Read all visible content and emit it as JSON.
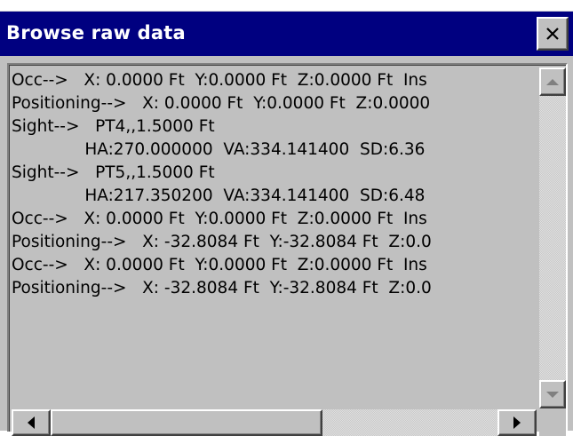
{
  "window": {
    "title": "Browse raw data",
    "close_icon": "close-icon",
    "colors": {
      "titlebar": "#000080",
      "title_text": "#ffffff",
      "face": "#c0c0c0"
    }
  },
  "raw_data": {
    "lines": [
      "Occ-->   X: 0.0000 Ft  Y:0.0000 Ft  Z:0.0000 Ft  Ins",
      "Positioning-->   X: 0.0000 Ft  Y:0.0000 Ft  Z:0.0000",
      "Sight-->   PT4,,1.5000 Ft",
      "              HA:270.000000  VA:334.141400  SD:6.36",
      "Sight-->   PT5,,1.5000 Ft",
      "              HA:217.350200  VA:334.141400  SD:6.48",
      "Occ-->   X: 0.0000 Ft  Y:0.0000 Ft  Z:0.0000 Ft  Ins",
      "Positioning-->   X: -32.8084 Ft  Y:-32.8084 Ft  Z:0.0",
      "Occ-->   X: 0.0000 Ft  Y:0.0000 Ft  Z:0.0000 Ft  Ins",
      "Positioning-->   X: -32.8084 Ft  Y:-32.8084 Ft  Z:0.0"
    ]
  },
  "scrollbars": {
    "vertical": {
      "up_icon": "arrow-up-icon",
      "down_icon": "arrow-down-icon"
    },
    "horizontal": {
      "left_icon": "arrow-left-icon",
      "right_icon": "arrow-right-icon",
      "position": 0.0
    }
  }
}
